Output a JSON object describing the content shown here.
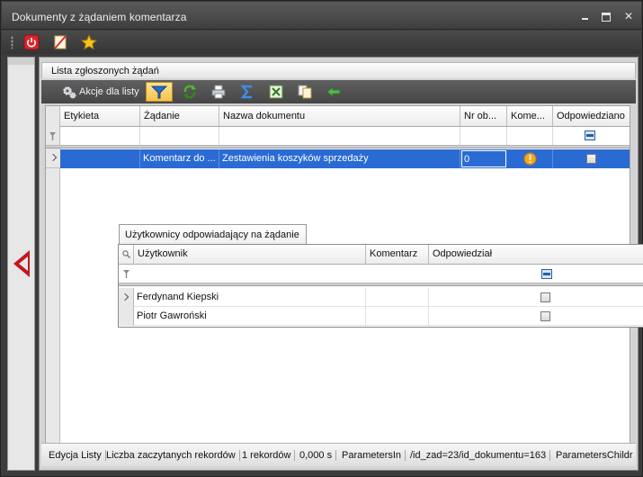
{
  "window": {
    "title": "Dokumenty z żądaniem komentarza"
  },
  "toolbar": {
    "icons": [
      "power-icon",
      "document-slash-icon",
      "star-icon"
    ]
  },
  "panel": {
    "title": "Lista zgłoszonych żądań",
    "grid_toolbar": {
      "actions_label": "Akcje dla listy",
      "icons": [
        "gears-icon",
        "filter-funnel-icon",
        "refresh-icon",
        "print-icon",
        "sum-icon",
        "export-excel-icon",
        "copy-icon",
        "navigate-icon"
      ]
    }
  },
  "grid": {
    "columns": [
      "Etykieta",
      "Żądanie",
      "Nazwa dokumentu",
      "Nr ob...",
      "Kome...",
      "Odpowiedziano"
    ],
    "rows": [
      {
        "etykieta": "",
        "zadanie": "Komentarz do ...",
        "nazwa_dokumentu": "Zestawienia koszyków sprzedaży",
        "nr_ob": "0",
        "komentarz_status": "warning",
        "odpowiedziano": false
      }
    ]
  },
  "detail": {
    "tab_label": "Użytkownicy odpowiadający na żądanie",
    "columns": [
      "Użytkownik",
      "Komentarz",
      "Odpowiedział"
    ],
    "rows": [
      {
        "uzytkownik": "Ferdynand Kiepski",
        "komentarz": "",
        "odpowiedzial": false
      },
      {
        "uzytkownik": "Piotr Gawroński",
        "komentarz": "",
        "odpowiedzial": false
      }
    ]
  },
  "statusbar": {
    "items": [
      "Edycja Listy",
      "Liczba zaczytanych rekordów",
      "1 rekordów",
      "0,000 s",
      "ParametersIn",
      "/id_zad=23/id_dokumentu=163",
      "ParametersChildr"
    ]
  },
  "colors": {
    "selection": "#2a6bd3",
    "chrome_dark": "#3c3c3c",
    "close_arrow": "#c4161c"
  }
}
